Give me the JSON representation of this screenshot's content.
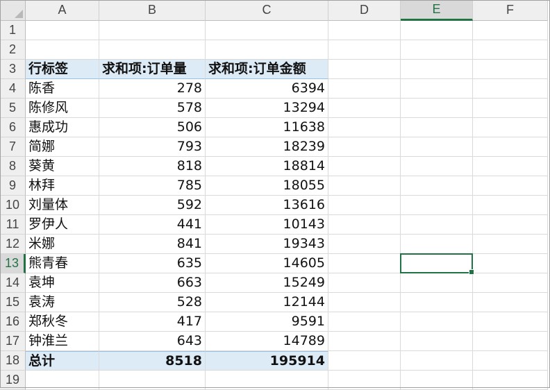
{
  "columns": [
    "A",
    "B",
    "C",
    "D",
    "E",
    "F"
  ],
  "active_column": "E",
  "active_row": "13",
  "row_numbers": [
    "1",
    "2",
    "3",
    "4",
    "5",
    "6",
    "7",
    "8",
    "9",
    "10",
    "11",
    "12",
    "13",
    "14",
    "15",
    "16",
    "17",
    "18",
    "19"
  ],
  "pivot": {
    "header": {
      "row_label": "行标签",
      "sum_qty": "求和项:订单量",
      "sum_amount": "求和项:订单金额"
    },
    "rows": [
      {
        "name": "陈香",
        "qty": "278",
        "amount": "6394"
      },
      {
        "name": "陈修风",
        "qty": "578",
        "amount": "13294"
      },
      {
        "name": "惠成功",
        "qty": "506",
        "amount": "11638"
      },
      {
        "name": "简娜",
        "qty": "793",
        "amount": "18239"
      },
      {
        "name": "葵黄",
        "qty": "818",
        "amount": "18814"
      },
      {
        "name": "林拜",
        "qty": "785",
        "amount": "18055"
      },
      {
        "name": "刘量体",
        "qty": "592",
        "amount": "13616"
      },
      {
        "name": "罗伊人",
        "qty": "441",
        "amount": "10143"
      },
      {
        "name": "米娜",
        "qty": "841",
        "amount": "19343"
      },
      {
        "name": "熊青春",
        "qty": "635",
        "amount": "14605"
      },
      {
        "name": "袁坤",
        "qty": "663",
        "amount": "15249"
      },
      {
        "name": "袁涛",
        "qty": "528",
        "amount": "12144"
      },
      {
        "name": "郑秋冬",
        "qty": "417",
        "amount": "9591"
      },
      {
        "name": "钟淮兰",
        "qty": "643",
        "amount": "14789"
      }
    ],
    "total": {
      "label": "总计",
      "qty": "8518",
      "amount": "195914"
    }
  },
  "colors": {
    "pivot_fill": "#ddebf7",
    "accent": "#217346"
  },
  "icons": {
    "filter": "dropdown-filter-icon"
  }
}
